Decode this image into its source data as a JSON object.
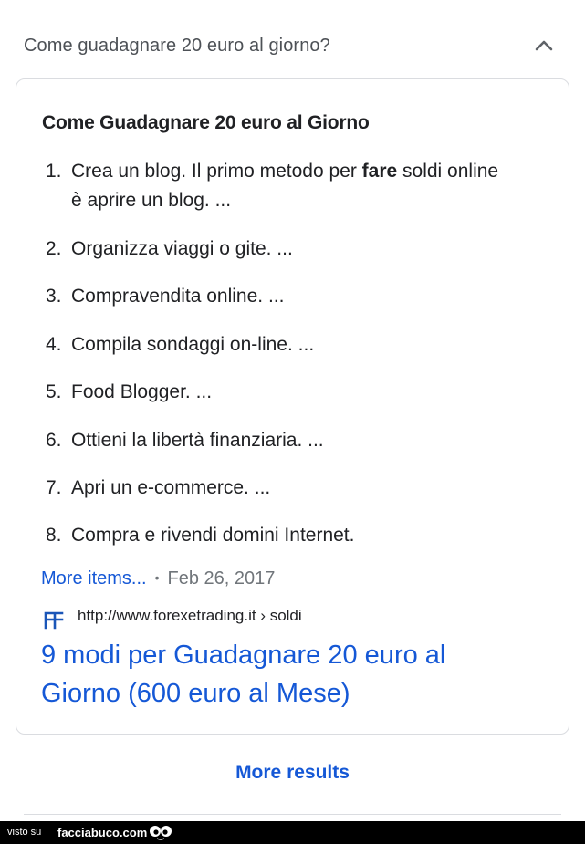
{
  "question": {
    "text": "Come guadagnare 20 euro al giorno?",
    "expanded": true
  },
  "card": {
    "heading": "Come Guadagnare 20 euro al Giorno",
    "steps": [
      {
        "num": "1.",
        "line1_pre": "Crea un blog. Il primo metodo per ",
        "line1_bold": "fare",
        "line1_post": " soldi online",
        "line2": "è aprire un blog. ..."
      },
      {
        "num": "2.",
        "text": "Organizza viaggi o gite. ..."
      },
      {
        "num": "3.",
        "text": "Compravendita online. ..."
      },
      {
        "num": "4.",
        "text": "Compila sondaggi on-line. ..."
      },
      {
        "num": "5.",
        "text": "Food Blogger. ..."
      },
      {
        "num": "6.",
        "text": "Ottieni la libertà finanziaria. ..."
      },
      {
        "num": "7.",
        "text": "Apri un e-commerce. ..."
      },
      {
        "num": "8.",
        "text": "Compra e rivendi domini Internet."
      }
    ],
    "more_items_label": "More items...",
    "separator": "•",
    "date": "Feb 26, 2017",
    "source_url": "http://www.forexetrading.it › soldi",
    "result_title_line1": "9 modi per Guadagnare 20 euro al",
    "result_title_line2": "Giorno (600 euro al Mese)"
  },
  "more_results_label": "More results",
  "footer": {
    "visto": "visto su",
    "brand": "facciabuco.com"
  },
  "colors": {
    "link": "#1558d6",
    "text": "#202124",
    "muted": "#70757a",
    "border": "#dadce0"
  },
  "icons": {
    "expand": "chevron-up-icon",
    "favicon": "forexetrading-favicon-icon",
    "footer_logo": "facciabuco-eyes-logo"
  }
}
